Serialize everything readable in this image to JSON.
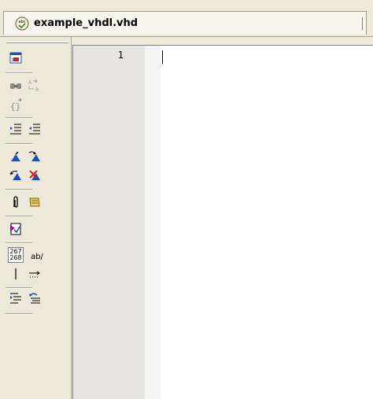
{
  "tab": {
    "title": "example_vhdl.vhd",
    "icon": "spellcheck-document-icon",
    "icon_text": "abc"
  },
  "editor": {
    "line_numbers": [
      "1"
    ],
    "lines": [
      ""
    ]
  },
  "toolbar": {
    "tools": [
      {
        "name": "toggle-display-icon"
      },
      {
        "name": "find-icon"
      },
      {
        "name": "replace-icon"
      },
      {
        "name": "brace-match-icon"
      },
      {
        "name": "indent-icon"
      },
      {
        "name": "outdent-icon"
      },
      {
        "name": "set-bookmark-icon"
      },
      {
        "name": "next-bookmark-icon"
      },
      {
        "name": "previous-bookmark-icon"
      },
      {
        "name": "clear-bookmarks-icon"
      },
      {
        "name": "paperclip-icon"
      },
      {
        "name": "scroll-icon"
      },
      {
        "name": "validate-icon"
      },
      {
        "name": "line-numbers-toggle-icon"
      },
      {
        "name": "word-wrap-toggle-icon"
      },
      {
        "name": "show-cursor-line-icon"
      },
      {
        "name": "show-spaces-icon"
      },
      {
        "name": "format-icon"
      },
      {
        "name": "undo-format-icon"
      }
    ],
    "line_numbers_glyph": [
      "267",
      "268"
    ],
    "word_wrap_glyph": "ab/"
  },
  "colors": {
    "chrome": "#ece9d8",
    "gutter": "#e5e4e0",
    "editor_bg": "#ffffff",
    "accent_blue": "#1d4fb8",
    "accent_red": "#d02020"
  }
}
